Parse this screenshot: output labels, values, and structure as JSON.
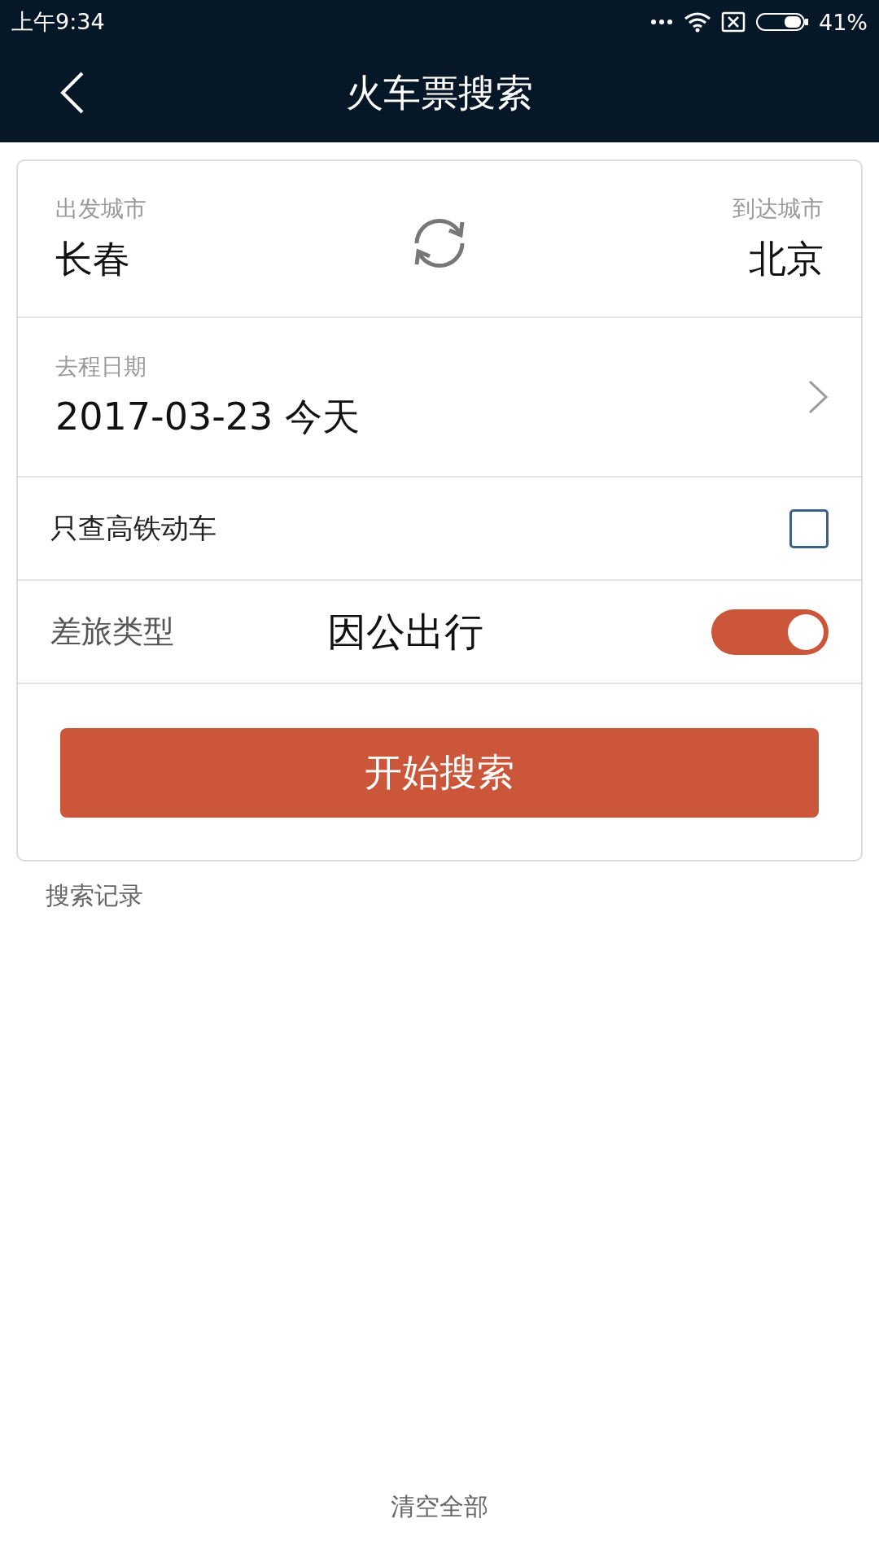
{
  "status_bar": {
    "time": "上午9:34",
    "battery": "41%"
  },
  "header": {
    "title": "火车票搜索"
  },
  "cities": {
    "from_label": "出发城市",
    "from": "长春",
    "to_label": "到达城市",
    "to": "北京"
  },
  "date": {
    "label": "去程日期",
    "value": "2017-03-23 今天"
  },
  "high_speed_only": {
    "label": "只查高铁动车",
    "checked": false
  },
  "travel_type": {
    "label": "差旅类型",
    "value": "因公出行",
    "on": true
  },
  "search_button": "开始搜索",
  "history": {
    "title": "搜索记录"
  },
  "clear_all": "清空全部"
}
